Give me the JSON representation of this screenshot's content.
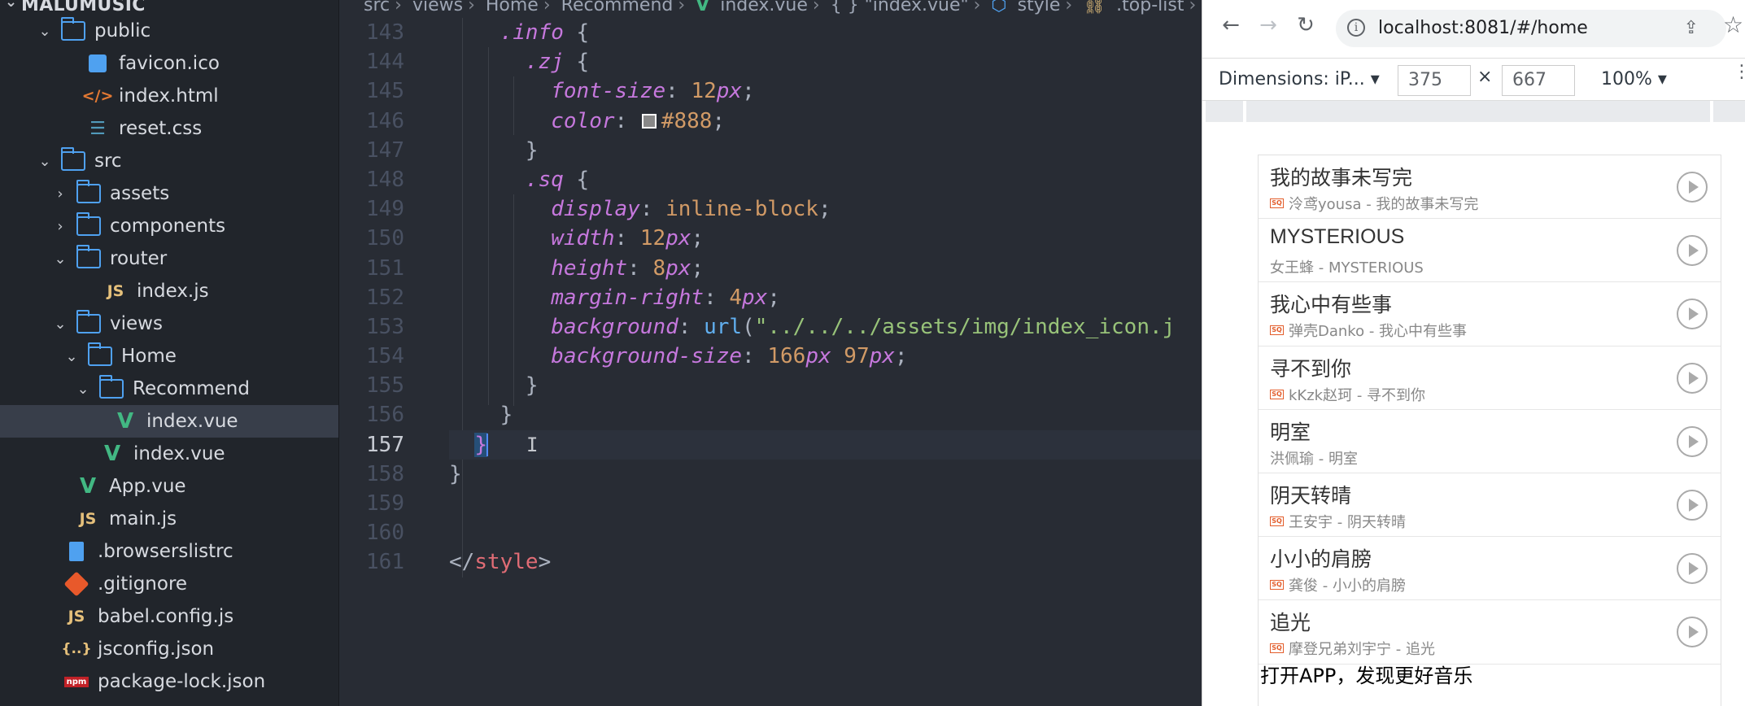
{
  "sidebar": {
    "header": "MALUMUSIC",
    "items": [
      {
        "label": "public"
      },
      {
        "label": "favicon.ico"
      },
      {
        "label": "index.html"
      },
      {
        "label": "reset.css"
      },
      {
        "label": "src"
      },
      {
        "label": "assets"
      },
      {
        "label": "components"
      },
      {
        "label": "router"
      },
      {
        "label": "index.js"
      },
      {
        "label": "views"
      },
      {
        "label": "Home"
      },
      {
        "label": "Recommend"
      },
      {
        "label": "index.vue"
      },
      {
        "label": "index.vue"
      },
      {
        "label": "App.vue"
      },
      {
        "label": "main.js"
      },
      {
        "label": ".browserslistrc"
      },
      {
        "label": ".gitignore"
      },
      {
        "label": "babel.config.js"
      },
      {
        "label": "jsconfig.json"
      },
      {
        "label": "package-lock.json"
      }
    ]
  },
  "breadcrumb": {
    "src": "src",
    "views": "views",
    "home": "Home",
    "recommend": "Recommend",
    "file": "index.vue",
    "scope": "{ } \"index.vue\"",
    "style": "style",
    "klass": ".top-list"
  },
  "editor": {
    "line_numbers": [
      "143",
      "144",
      "145",
      "146",
      "147",
      "148",
      "149",
      "150",
      "151",
      "152",
      "153",
      "154",
      "155",
      "156",
      "157",
      "158",
      "159",
      "160",
      "161"
    ],
    "code": {
      "info_sel": ".info",
      "zj_sel": ".zj",
      "sq_sel": ".sq",
      "font_size_prop": "font-size",
      "color_prop": "color",
      "display_prop": "display",
      "width_prop": "width",
      "height_prop": "height",
      "margin_right_prop": "margin-right",
      "background_prop": "background",
      "background_size_prop": "background-size",
      "n12": "12",
      "n8": "8",
      "n4": "4",
      "n166": "166",
      "n97": "97",
      "px": "px",
      "color_value": "#888",
      "display_value": "inline-block",
      "url_fn": "url",
      "url_string": "\"../../../assets/img/index_icon.j",
      "style_close_tag": "style"
    },
    "swatch_color": "#888888"
  },
  "browser": {
    "url": "localhost:8081/#/home",
    "device_label": "Dimensions: iP...",
    "width": "375",
    "height": "667",
    "zoom": "100%"
  },
  "songs": [
    {
      "title": "我的故事未写完",
      "subtitle": "泠鸢yousa - 我的故事未写完",
      "sq": true
    },
    {
      "title": "MYSTERIOUS",
      "subtitle": "女王蜂 - MYSTERIOUS",
      "sq": false
    },
    {
      "title": "我心中有些事",
      "subtitle": "弹壳Danko - 我心中有些事",
      "sq": true
    },
    {
      "title": "寻不到你",
      "subtitle": "kKzk赵珂 - 寻不到你",
      "sq": true
    },
    {
      "title": "明室",
      "subtitle": "洪佩瑜 - 明室",
      "sq": false
    },
    {
      "title": "阴天转晴",
      "subtitle": "王安宇 - 阴天转晴",
      "sq": true
    },
    {
      "title": "小小的肩膀",
      "subtitle": "龚俊 - 小小的肩膀",
      "sq": true
    },
    {
      "title": "追光",
      "subtitle": "摩登兄弟刘宇宁 - 追光",
      "sq": true
    }
  ],
  "sq_badge": "SQ",
  "footer_text": "打开APP，发现更好音乐"
}
